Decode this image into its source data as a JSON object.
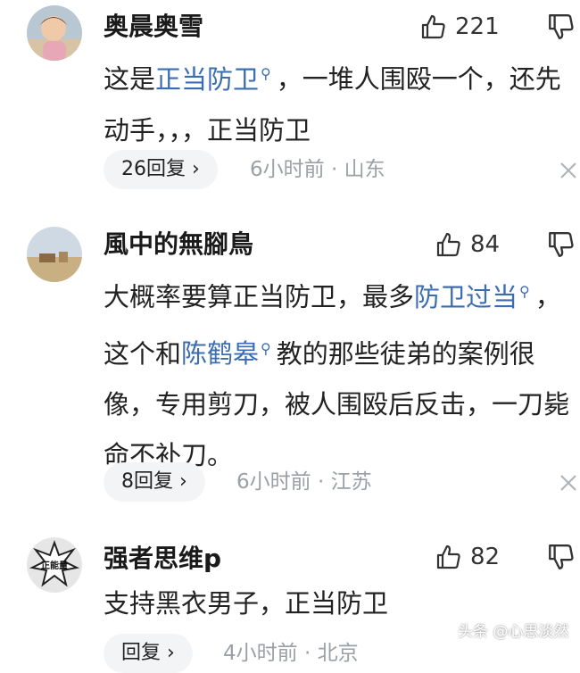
{
  "comments": [
    {
      "username": "奥晨奥雪",
      "likes": "221",
      "text": [
        {
          "t": "这是"
        },
        {
          "t": "正当防卫",
          "link": true
        },
        {
          "t": "，一堆人围殴一个，还先动手，，，正当防卫"
        }
      ],
      "replies": "26回复",
      "meta": "6小时前 · 山东"
    },
    {
      "username": "風中的無腳鳥",
      "likes": "84",
      "text": [
        {
          "t": "大概率要算正当防卫，最多"
        },
        {
          "t": "防卫过当",
          "link": true
        },
        {
          "t": "，这个和"
        },
        {
          "t": "陈鹤皋",
          "link": true
        },
        {
          "t": "教的那些徒弟的案例很像，专用剪刀，被人围殴后反击，一刀毙命不补刀。"
        }
      ],
      "replies": "8回复",
      "meta": "6小时前 · 江苏"
    },
    {
      "username": "强者思维p",
      "likes": "82",
      "text": [
        {
          "t": "支持黑衣男子，正当防卫"
        }
      ],
      "replies": "回复",
      "meta": "4小时前 · 北京"
    }
  ],
  "icons": {
    "like": "thumbs-up-icon",
    "dislike": "thumbs-down-icon",
    "search_link": "search-link-icon",
    "chevron": "chevron-right-icon",
    "close": "close-icon"
  },
  "avatar_badge": "正能量",
  "watermark": "头条 @心思淡然",
  "colors": {
    "link": "#3b6db3",
    "meta": "#9aa0a6",
    "pill_bg": "#f3f4f6"
  }
}
